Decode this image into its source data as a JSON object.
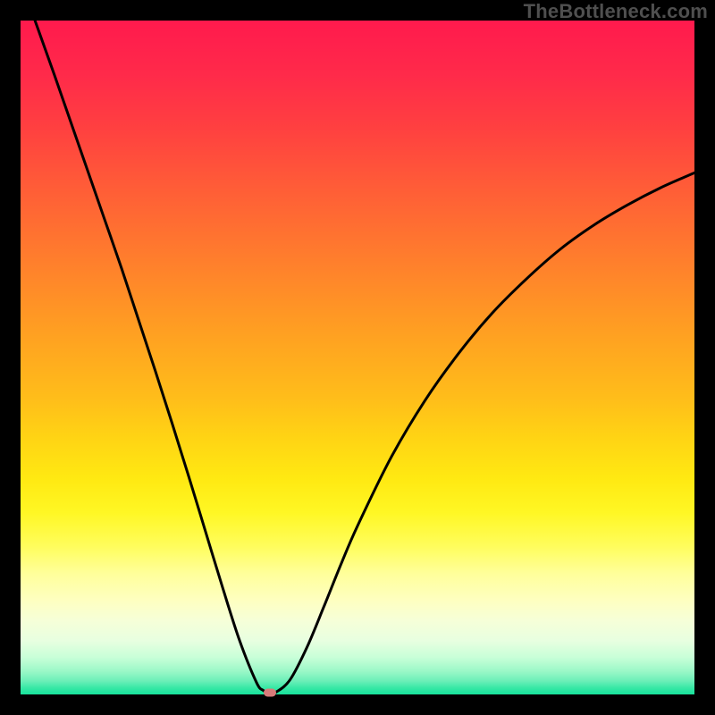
{
  "watermark": "TheBottleneck.com",
  "chart_data": {
    "type": "line",
    "title": "",
    "xlabel": "",
    "ylabel": "",
    "xlim": [
      0,
      100
    ],
    "ylim": [
      0,
      100
    ],
    "grid": false,
    "legend": false,
    "background": "rainbow-vertical-red-to-green",
    "series": [
      {
        "name": "bottleneck-curve",
        "color": "#000000",
        "x": [
          0,
          2.5,
          5,
          7.5,
          10,
          12.5,
          15,
          17.5,
          20,
          22.5,
          25,
          27.5,
          30,
          32.5,
          35,
          36,
          37,
          38,
          40,
          42.5,
          45,
          47.5,
          50,
          55,
          60,
          65,
          70,
          75,
          80,
          85,
          90,
          95,
          100
        ],
        "y": [
          106,
          99,
          92,
          84.8,
          77.6,
          70.4,
          63.2,
          55.6,
          48,
          40.2,
          32.2,
          24,
          15.8,
          8,
          1.8,
          0.6,
          0.2,
          0.4,
          2.2,
          7,
          13,
          19.2,
          25,
          35.2,
          43.6,
          50.6,
          56.6,
          61.6,
          66,
          69.6,
          72.6,
          75.2,
          77.4
        ]
      }
    ],
    "marker": {
      "name": "optimal-point",
      "x": 37,
      "y": 0.2,
      "color": "#d77b7a"
    }
  }
}
